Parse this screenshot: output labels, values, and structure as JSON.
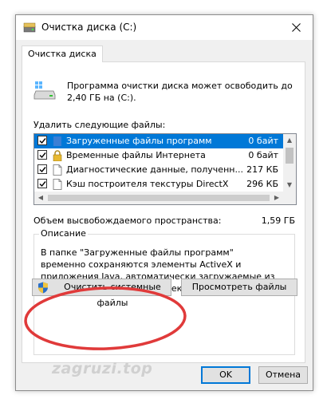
{
  "window": {
    "title": "Очистка диска  (C:)"
  },
  "tab": {
    "label": "Очистка диска"
  },
  "intro": {
    "text": "Программа очистки диска может освободить до 2,40 ГБ на  (C:)."
  },
  "delete_label": "Удалить следующие файлы:",
  "files": [
    {
      "name": "Загруженные файлы программ",
      "size": "0 байт",
      "checked": true,
      "selected": true,
      "icon": "folder-icon"
    },
    {
      "name": "Временные файлы Интернета",
      "size": "0 байт",
      "checked": true,
      "selected": false,
      "icon": "lock-icon"
    },
    {
      "name": "Диагностические данные, полученн...",
      "size": "217 КБ",
      "checked": true,
      "selected": false,
      "icon": "file-icon"
    },
    {
      "name": "Кэш построителя текстуры DirectX",
      "size": "296 КБ",
      "checked": true,
      "selected": false,
      "icon": "file-icon"
    }
  ],
  "space": {
    "label": "Объем высвобождаемого пространства:",
    "value": "1,59 ГБ"
  },
  "description": {
    "legend": "Описание",
    "text": "В папке \"Загруженные файлы программ\" временно сохраняются элементы ActiveX и приложения Java, автоматически загружаемые из Интернета при просмотре некоторых страниц."
  },
  "buttons": {
    "clean_system": "Очистить системные файлы",
    "view_files": "Просмотреть файлы",
    "ok": "OK",
    "cancel": "Отмена"
  },
  "watermark": "zagruzi.top",
  "colors": {
    "selection": "#0078d7",
    "highlight_ellipse": "#e03a3a"
  }
}
